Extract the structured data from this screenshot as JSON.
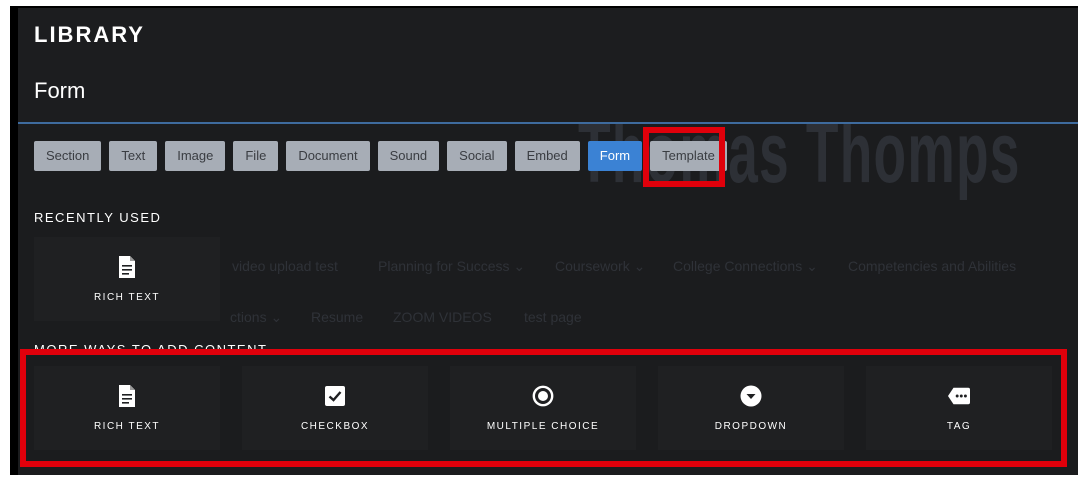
{
  "header": {
    "title": "LIBRARY",
    "subtitle": "Form"
  },
  "tabs": [
    {
      "label": "Section"
    },
    {
      "label": "Text"
    },
    {
      "label": "Image"
    },
    {
      "label": "File"
    },
    {
      "label": "Document"
    },
    {
      "label": "Sound"
    },
    {
      "label": "Social"
    },
    {
      "label": "Embed"
    },
    {
      "label": "Form",
      "active": true
    },
    {
      "label": "Template"
    }
  ],
  "recently_used": {
    "label": "RECENTLY USED",
    "items": [
      {
        "label": "RICH TEXT",
        "icon": "document-icon"
      }
    ]
  },
  "more_ways": {
    "label": "MORE WAYS TO ADD CONTENT",
    "items": [
      {
        "label": "RICH TEXT",
        "icon": "document-icon"
      },
      {
        "label": "CHECKBOX",
        "icon": "checkbox-icon"
      },
      {
        "label": "MULTIPLE CHOICE",
        "icon": "radio-icon"
      },
      {
        "label": "DROPDOWN",
        "icon": "dropdown-icon"
      },
      {
        "label": "TAG",
        "icon": "tag-icon"
      }
    ]
  },
  "background": {
    "heading": "Thomas Thomps",
    "nav_row1": [
      "video upload test",
      "Planning for Success ⌄",
      "Coursework ⌄",
      "College Connections ⌄",
      "Competencies and Abilities"
    ],
    "nav_row2": [
      "ctions ⌄",
      "Resume",
      "ZOOM VIDEOS",
      "test page"
    ]
  },
  "colors": {
    "highlight": "#e0000b",
    "active_tab": "#3b82d4",
    "tab": "#a7adb6",
    "accent_line": "#3e6b9e"
  }
}
